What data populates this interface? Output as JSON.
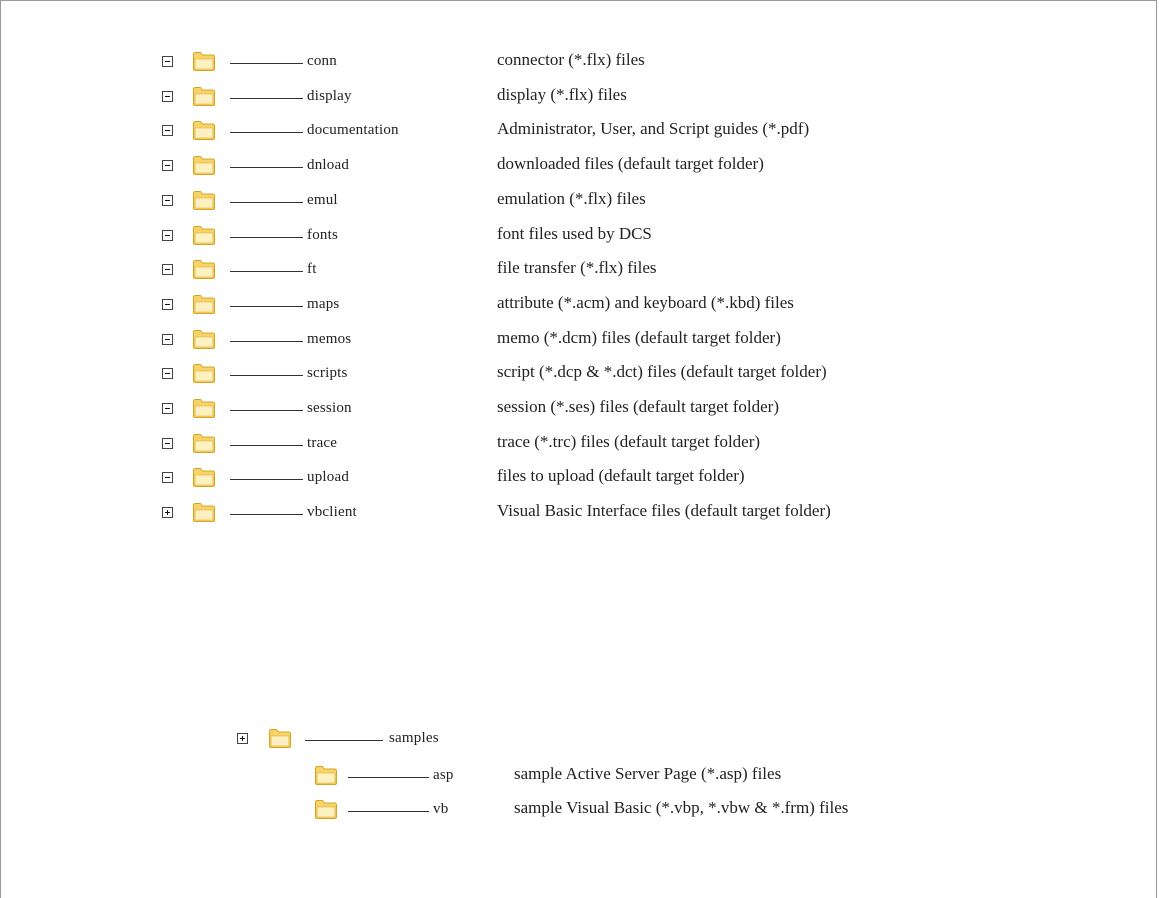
{
  "folders": [
    {
      "name": "conn",
      "desc": "connector (*.flx) files",
      "toggle": "minus"
    },
    {
      "name": "display",
      "desc": "display (*.flx) files",
      "toggle": "minus"
    },
    {
      "name": "documentation",
      "desc": "Administrator, User, and Script guides (*.pdf)",
      "toggle": "minus"
    },
    {
      "name": "dnload",
      "desc": "downloaded files (default target folder)",
      "toggle": "minus"
    },
    {
      "name": "emul",
      "desc": "emulation (*.flx) files",
      "toggle": "minus"
    },
    {
      "name": "fonts",
      "desc": "font files used by DCS",
      "toggle": "minus"
    },
    {
      "name": "ft",
      "desc": "file transfer (*.flx) files",
      "toggle": "minus"
    },
    {
      "name": "maps",
      "desc": "attribute (*.acm) and keyboard (*.kbd) files",
      "toggle": "minus"
    },
    {
      "name": "memos",
      "desc": "memo (*.dcm) files (default target folder)",
      "toggle": "minus"
    },
    {
      "name": "scripts",
      "desc": "script (*.dcp & *.dct) files (default target folder)",
      "toggle": "minus"
    },
    {
      "name": "session",
      "desc": "session (*.ses) files (default target folder)",
      "toggle": "minus"
    },
    {
      "name": "trace",
      "desc": "trace (*.trc) files (default target folder)",
      "toggle": "minus"
    },
    {
      "name": "upload",
      "desc": "files to upload (default target folder)",
      "toggle": "minus"
    },
    {
      "name": "vbclient",
      "desc": "Visual Basic Interface files (default target folder)",
      "toggle": "plus"
    }
  ],
  "subfolders": [
    {
      "name": "samples",
      "desc": "",
      "toggle": "plus"
    }
  ],
  "subsubfolders": [
    {
      "name": "asp",
      "desc": "sample Active Server Page (*.asp) files"
    },
    {
      "name": "vb",
      "desc": "sample Visual Basic (*.vbp, *.vbw & *.frm) files"
    }
  ],
  "colors": {
    "folder_body": "#f7d46a",
    "folder_light": "#fdf1c2",
    "folder_edge": "#d9a521"
  },
  "icons": {
    "folder": "folder-icon",
    "collapse": "collapse-icon",
    "expand": "expand-icon"
  }
}
